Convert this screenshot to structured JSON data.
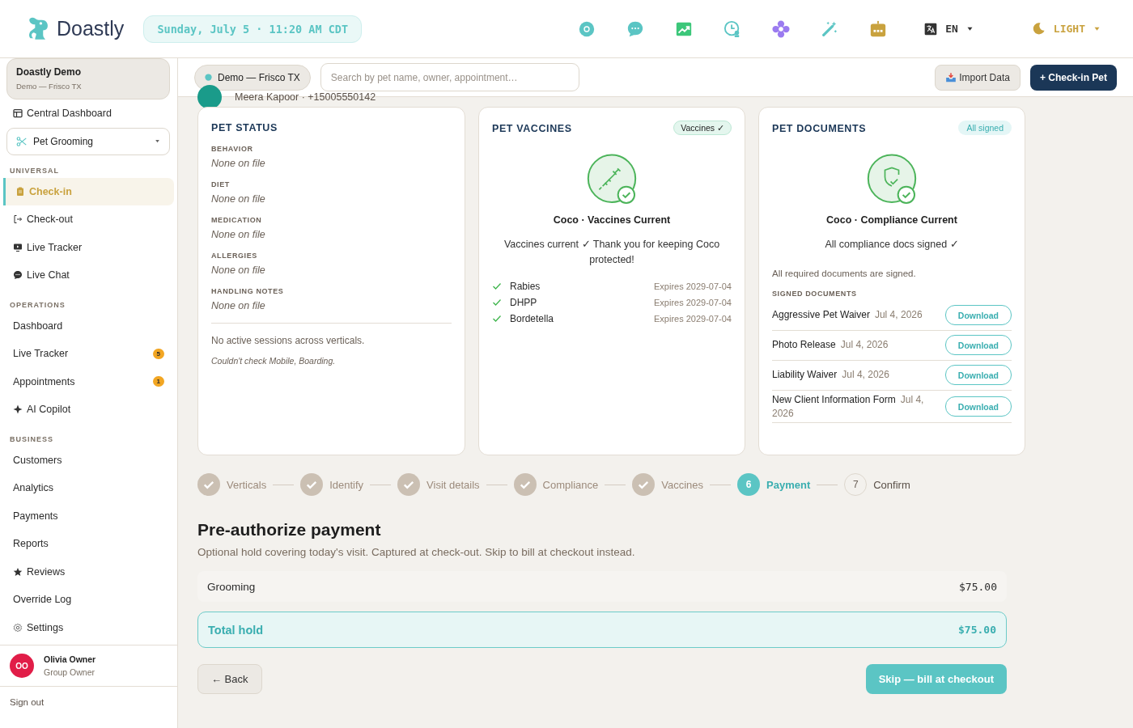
{
  "header": {
    "brand": "Doastly",
    "datetime": "Sunday, July 5 · 11:20 AM CDT",
    "language": "EN",
    "theme": "LIGHT"
  },
  "sidebar": {
    "org": {
      "name": "Doastly Demo",
      "sub": "Demo — Frisco TX"
    },
    "top_link": "Central Dashboard",
    "vertical": "Pet Grooming",
    "sections": [
      {
        "title": "UNIVERSAL",
        "items": [
          {
            "label": "Check-in",
            "selected": true
          },
          {
            "label": "Check-out",
            "selected": false
          },
          {
            "label": "Live Tracker",
            "selected": false
          },
          {
            "label": "Live Chat",
            "selected": false
          }
        ]
      },
      {
        "title": "OPERATIONS",
        "items": [
          {
            "label": "Dashboard",
            "selected": false
          },
          {
            "label": "Live Tracker",
            "selected": false,
            "badge": "5"
          },
          {
            "label": "Appointments",
            "selected": false,
            "badge": "1"
          },
          {
            "label": "AI Copilot",
            "selected": false
          }
        ]
      },
      {
        "title": "BUSINESS",
        "items": [
          {
            "label": "Customers",
            "selected": false
          },
          {
            "label": "Analytics",
            "selected": false
          },
          {
            "label": "Payments",
            "selected": false
          },
          {
            "label": "Reports",
            "selected": false
          },
          {
            "label": "Reviews",
            "selected": false
          },
          {
            "label": "Override Log",
            "selected": false
          },
          {
            "label": "Settings",
            "selected": false
          }
        ]
      }
    ],
    "user": {
      "initials": "OO",
      "name": "Olivia Owner",
      "role": "Group Owner"
    },
    "sign_out": "Sign out"
  },
  "toolbar": {
    "location": "Demo — Frisco TX",
    "search": {
      "placeholder": "Search by pet name, owner, appointment…"
    },
    "import": "Import Data",
    "checkin": "+ Check-in Pet"
  },
  "customer": {
    "text": "Meera Kapoor · +15005550142"
  },
  "pet_status": {
    "title": "PET STATUS",
    "fields": [
      {
        "label": "BEHAVIOR",
        "value": "None on file"
      },
      {
        "label": "DIET",
        "value": "None on file"
      },
      {
        "label": "MEDICATION",
        "value": "None on file"
      },
      {
        "label": "ALLERGIES",
        "value": "None on file"
      },
      {
        "label": "HANDLING NOTES",
        "value": "None on file"
      }
    ],
    "sessions": "No active sessions across verticals.",
    "note": "Couldn't check Mobile, Boarding."
  },
  "pet_vaccines": {
    "title": "PET VACCINES",
    "badge": "Vaccines ✓",
    "heading": "Coco · Vaccines Current",
    "message": "Vaccines current ✓ Thank you for keeping Coco protected!",
    "vaccines": [
      {
        "name": "Rabies",
        "expires": "Expires 2029-07-04"
      },
      {
        "name": "DHPP",
        "expires": "Expires 2029-07-04"
      },
      {
        "name": "Bordetella",
        "expires": "Expires 2029-07-04"
      }
    ]
  },
  "pet_documents": {
    "title": "PET DOCUMENTS",
    "badge": "All signed",
    "heading": "Coco · Compliance Current",
    "message": "All compliance docs signed ✓",
    "note": "All required documents are signed.",
    "list_title": "SIGNED DOCUMENTS",
    "documents": [
      {
        "name": "Aggressive Pet Waiver",
        "date": "Jul 4, 2026",
        "action": "Download"
      },
      {
        "name": "Photo Release",
        "date": "Jul 4, 2026",
        "action": "Download"
      },
      {
        "name": "Liability Waiver",
        "date": "Jul 4, 2026",
        "action": "Download"
      },
      {
        "name": "New Client Information Form",
        "date": "Jul 4, 2026",
        "action": "Download"
      }
    ]
  },
  "steps": [
    {
      "label": "Verticals",
      "kind": "done"
    },
    {
      "label": "Identify",
      "kind": "done"
    },
    {
      "label": "Visit details",
      "kind": "done"
    },
    {
      "label": "Compliance",
      "kind": "done"
    },
    {
      "label": "Vaccines",
      "kind": "done"
    },
    {
      "number": "6",
      "label": "Payment",
      "kind": "current"
    },
    {
      "number": "7",
      "label": "Confirm",
      "kind": "pending"
    }
  ],
  "payment": {
    "title": "Pre-authorize payment",
    "subtitle": "Optional hold covering today's visit. Captured at check-out. Skip to bill at checkout instead.",
    "lines": [
      {
        "label": "Grooming",
        "amount": "$75.00"
      }
    ],
    "total": {
      "label": "Total hold",
      "amount": "$75.00"
    },
    "back": "← Back",
    "skip": "Skip — bill at checkout"
  }
}
